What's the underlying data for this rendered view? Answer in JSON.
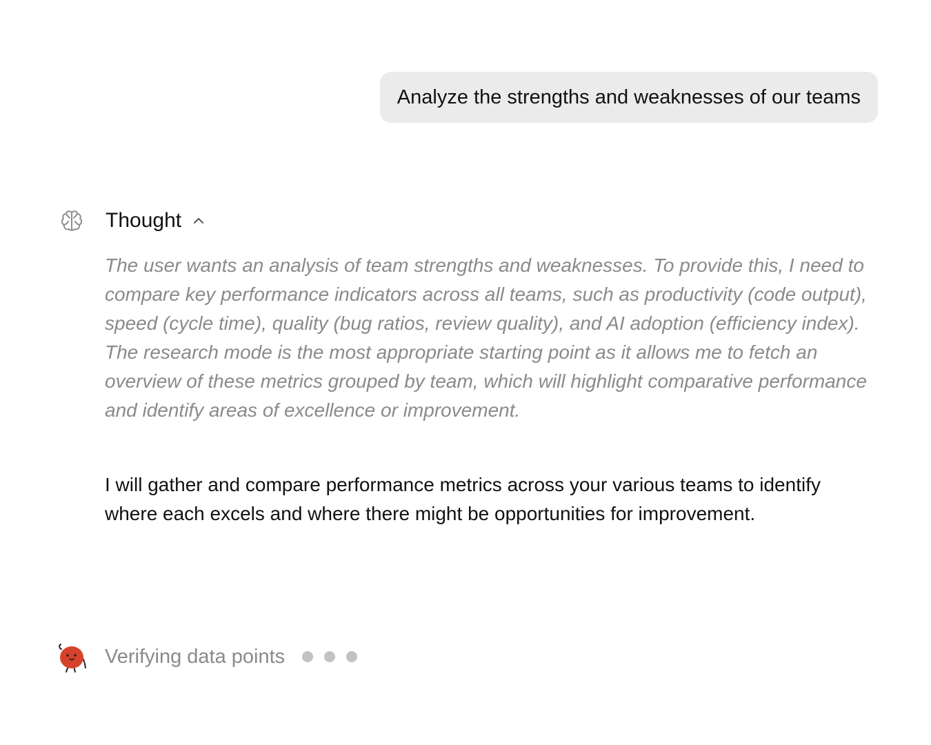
{
  "user_message": {
    "text": "Analyze the strengths and weaknesses of our teams"
  },
  "thought": {
    "label": "Thought",
    "icon": "brain-icon",
    "toggle_icon": "chevron-up-icon",
    "content": "The user wants an analysis of team strengths and weaknesses. To provide this, I need to compare key performance indicators across all teams, such as productivity (code output), speed (cycle time), quality (bug ratios, review quality), and AI adoption (efficiency index). The research mode is the most appropriate starting point as it allows me to fetch an overview of these metrics grouped by team, which will highlight comparative performance and identify areas of excellence or improvement."
  },
  "response": {
    "text": "I will gather and compare performance metrics across your various teams to identify where each excels and where there might be opportunities for improvement."
  },
  "status": {
    "text": "Verifying data points",
    "icon": "mascot-icon",
    "loading_dots": 3
  },
  "colors": {
    "bubble": "#ebebeb",
    "muted_text": "#8a8a8a",
    "dot": "#c2c2c2",
    "mascot": "#d6432a"
  }
}
